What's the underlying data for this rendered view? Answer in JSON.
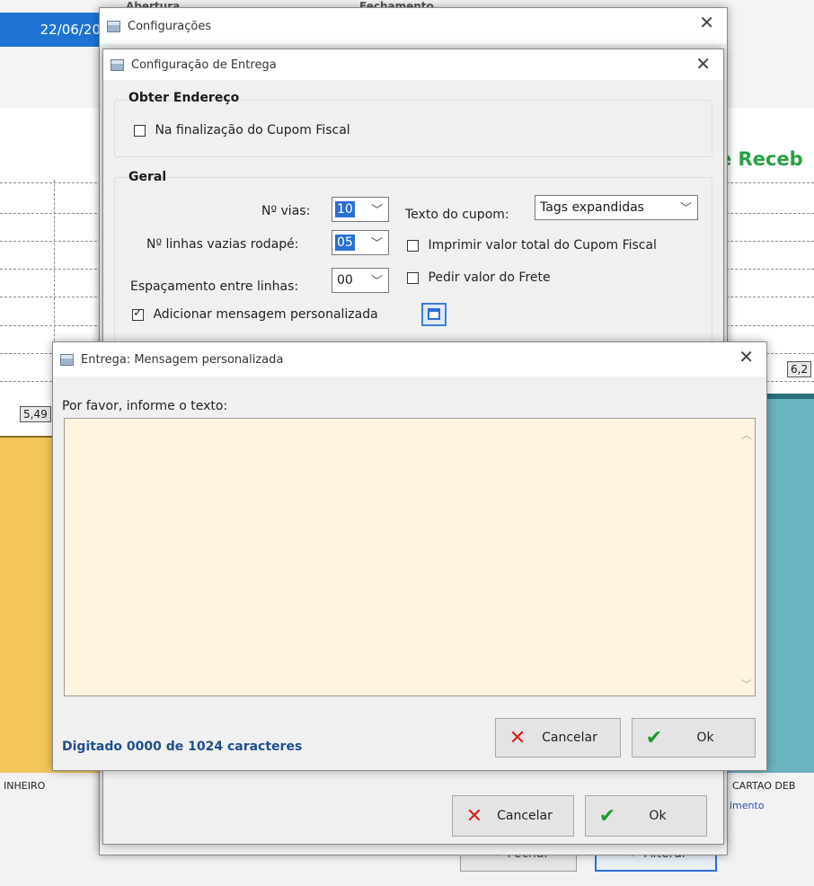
{
  "background": {
    "date_text": "22/06/20",
    "top_label_left": "Abertura",
    "top_label_right": "Fechamento",
    "heading_fragment": "e Receb",
    "value_left": "5,49",
    "value_right": "6,2",
    "category_left": "INHEIRO",
    "category_right": "CARTAO DEB",
    "category_right_sub": "imento",
    "fechar_label": "Fechar",
    "alterar_label": "Alterar",
    "colors": {
      "bar_left": "#f4c55a",
      "bar_right": "#6ab3bf",
      "heading": "#27a045",
      "date_bg": "#1e73d2"
    }
  },
  "config_window": {
    "title": "Configurações"
  },
  "entrega_window": {
    "title": "Configuração de Entrega",
    "obter_group_title": "Obter Endereço",
    "finalizacao_label": "Na finalização do Cupom Fiscal",
    "finalizacao_checked": false,
    "geral_group_title": "Geral",
    "vias_label": "Nº vias:",
    "vias_value": "10",
    "linhas_vazias_label": "Nº linhas vazias rodapé:",
    "linhas_vazias_value": "05",
    "espacamento_label": "Espaçamento entre linhas:",
    "espacamento_value": "00",
    "texto_cupom_label": "Texto do cupom:",
    "texto_cupom_value": "Tags expandidas",
    "imprimir_total_label": "Imprimir valor total do Cupom Fiscal",
    "imprimir_total_checked": false,
    "pedir_frete_label": "Pedir valor do Frete",
    "pedir_frete_checked": false,
    "mensagem_label": "Adicionar mensagem personalizada",
    "mensagem_checked": true,
    "cancel_label": "Cancelar",
    "ok_label": "Ok"
  },
  "mensagem_dialog": {
    "title": "Entrega: Mensagem personalizada",
    "prompt": "Por favor, informe o texto:",
    "text_value": "",
    "counter": "Digitado 0000 de 1024 caracteres",
    "cancel_label": "Cancelar",
    "ok_label": "Ok",
    "counter_color": "#1f4f8a"
  }
}
